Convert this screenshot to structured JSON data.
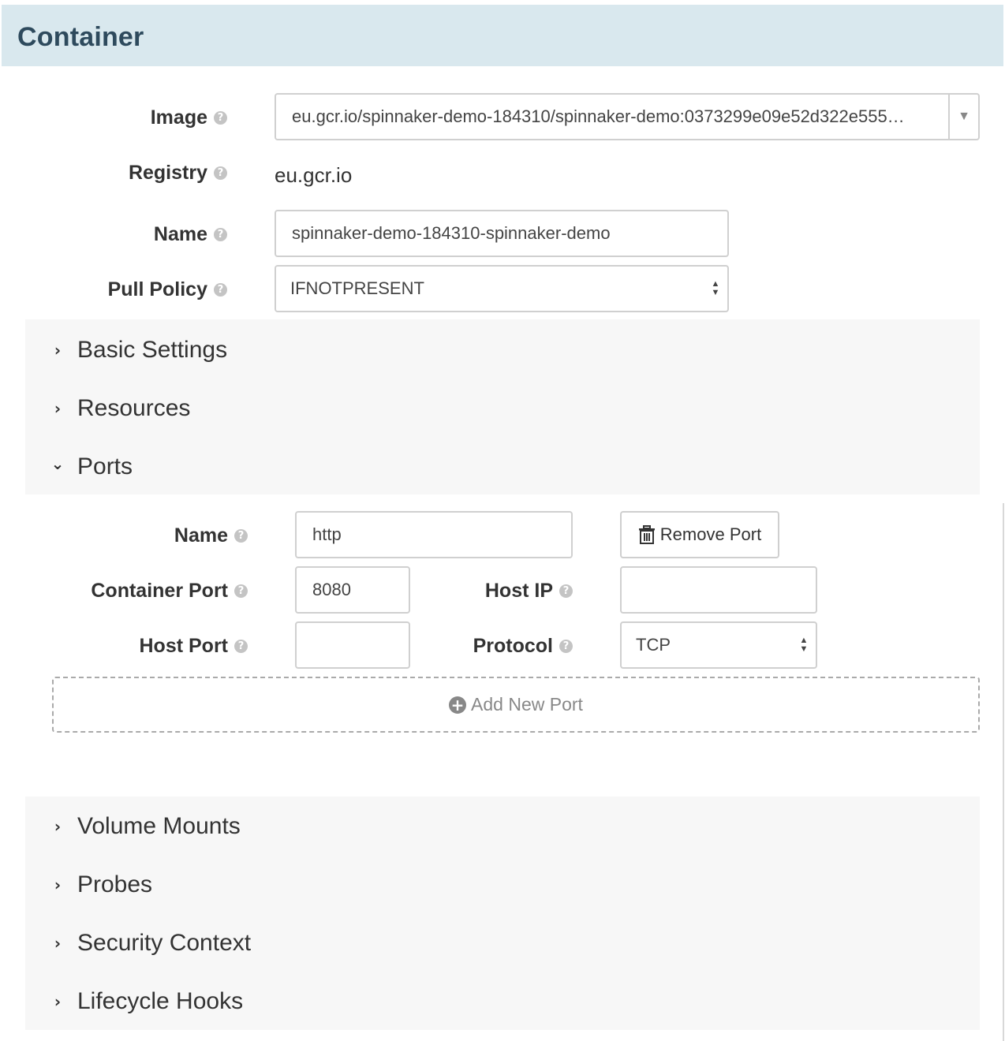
{
  "header": {
    "title": "Container"
  },
  "help_glyph": "?",
  "form": {
    "image": {
      "label": "Image",
      "value": "eu.gcr.io/spinnaker-demo-184310/spinnaker-demo:0373299e09e52d322e555…"
    },
    "registry": {
      "label": "Registry",
      "value": "eu.gcr.io"
    },
    "name": {
      "label": "Name",
      "value": "spinnaker-demo-184310-spinnaker-demo"
    },
    "pull_policy": {
      "label": "Pull Policy",
      "value": "IFNOTPRESENT"
    }
  },
  "sections_top": [
    {
      "label": "Basic Settings",
      "expanded": false
    },
    {
      "label": "Resources",
      "expanded": false
    },
    {
      "label": "Ports",
      "expanded": true
    }
  ],
  "ports": {
    "name": {
      "label": "Name",
      "value": "http"
    },
    "remove_label": "Remove Port",
    "container_port": {
      "label": "Container Port",
      "value": "8080"
    },
    "host_ip": {
      "label": "Host IP",
      "value": ""
    },
    "host_port": {
      "label": "Host Port",
      "value": ""
    },
    "protocol": {
      "label": "Protocol",
      "value": "TCP"
    },
    "add_label": "Add New Port"
  },
  "sections_bottom": [
    {
      "label": "Volume Mounts",
      "expanded": false
    },
    {
      "label": "Probes",
      "expanded": false
    },
    {
      "label": "Security Context",
      "expanded": false
    },
    {
      "label": "Lifecycle Hooks",
      "expanded": false
    }
  ],
  "icons": {
    "chevron_right": "›",
    "chevron_down": "⌄",
    "trash": "trash-icon",
    "plus": "+"
  },
  "colors": {
    "header_bg": "#d9e8ee",
    "header_text": "#2e4a5d",
    "section_bg": "#f7f7f7"
  }
}
